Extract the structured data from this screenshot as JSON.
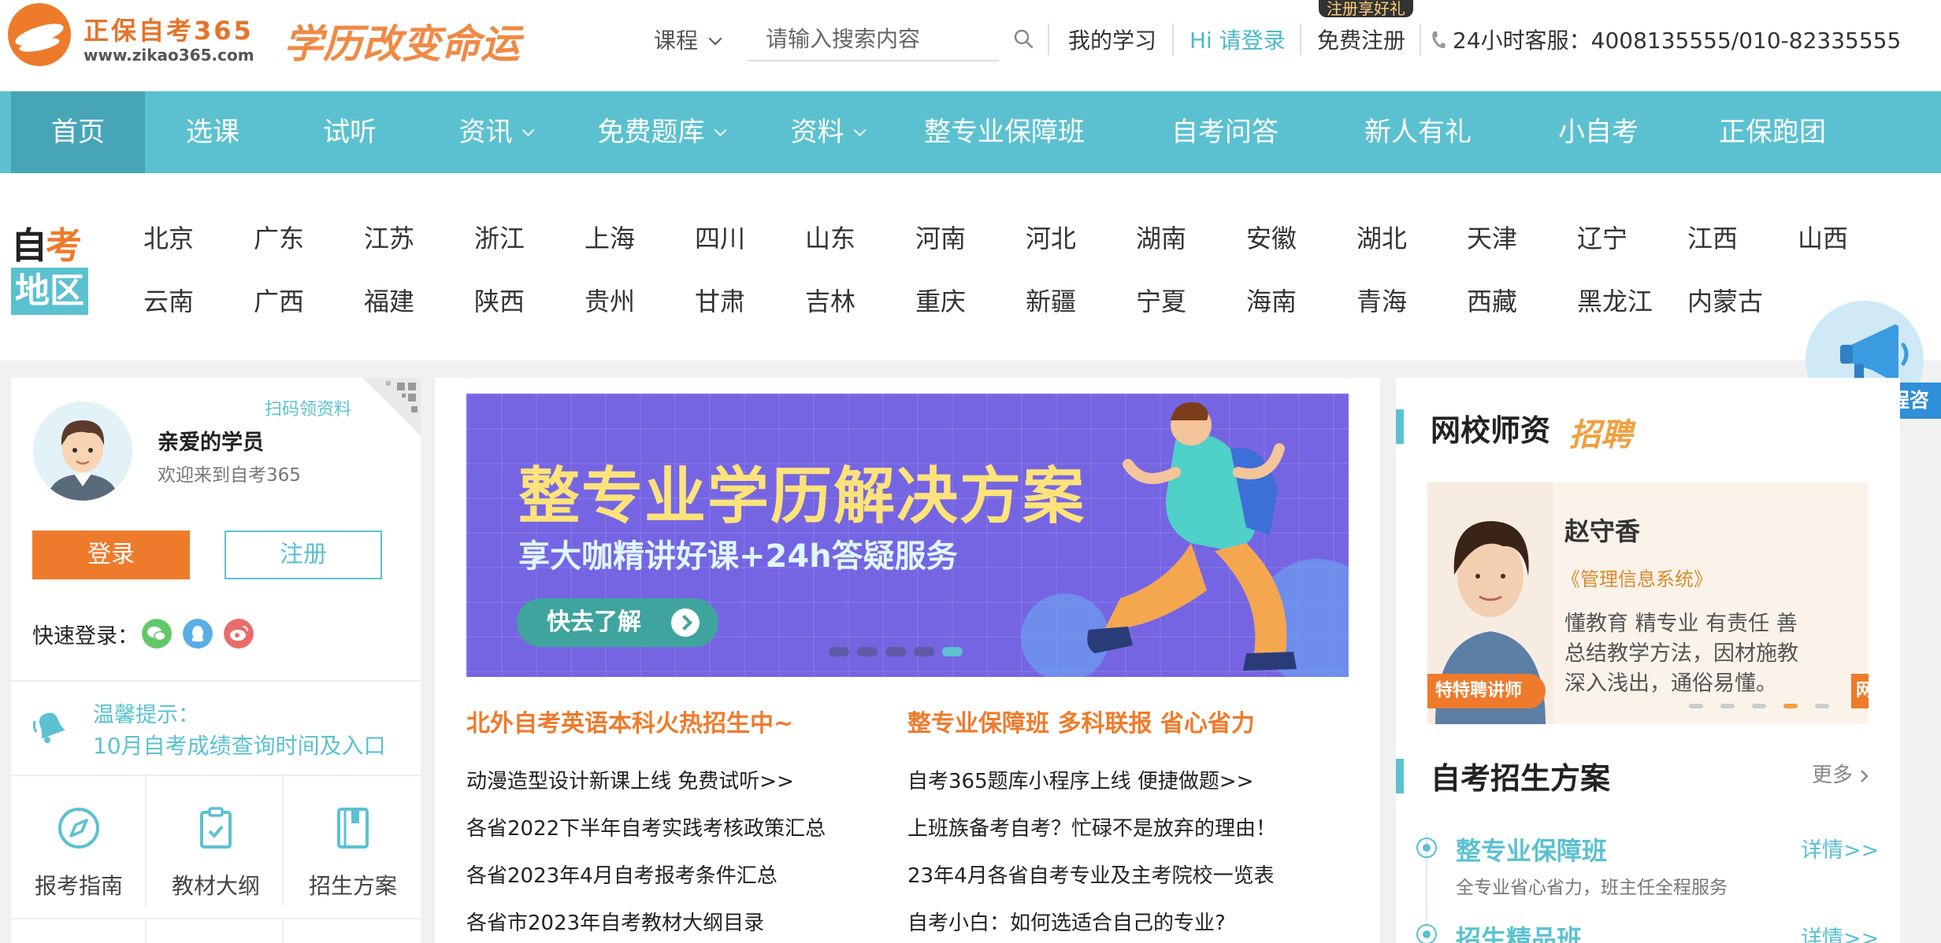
{
  "header": {
    "logo_title": "正保自考365",
    "logo_url": "www.zikao365.com",
    "slogan": "学历改变命运",
    "course_select": "课程",
    "search_placeholder": "请输入搜索内容",
    "my_study": "我的学习",
    "login": "Hi 请登录",
    "register": "免费注册",
    "register_tip": "注册享好礼",
    "service": "24小时客服：4008135555/010-82335555",
    "accent_color": "#5bc1d1",
    "brand_color": "#ee7b2c"
  },
  "nav": {
    "items": [
      {
        "label": "首页"
      },
      {
        "label": "选课"
      },
      {
        "label": "试听"
      },
      {
        "label": "资讯"
      },
      {
        "label": "免费题库"
      },
      {
        "label": "资料"
      },
      {
        "label": "整专业保障班"
      },
      {
        "label": "自考问答"
      },
      {
        "label": "新人有礼"
      },
      {
        "label": "小自考"
      },
      {
        "label": "正保跑团"
      }
    ]
  },
  "region": {
    "tag_line1_a": "自",
    "tag_line1_b": "考",
    "tag_line2": "地区",
    "provinces_row1": [
      "北京",
      "广东",
      "江苏",
      "浙江",
      "上海",
      "四川",
      "山东",
      "河南",
      "河北",
      "湖南",
      "安徽",
      "湖北",
      "天津",
      "辽宁",
      "江西",
      "山西"
    ],
    "provinces_row2": [
      "云南",
      "广西",
      "福建",
      "陕西",
      "贵州",
      "甘肃",
      "吉林",
      "重庆",
      "新疆",
      "宁夏",
      "海南",
      "青海",
      "西藏",
      "黑龙江",
      "内蒙古"
    ]
  },
  "megaphone": {
    "label": "自考报考流程咨"
  },
  "user_panel": {
    "scan_label": "扫码领资料",
    "user_name": "亲爱的学员",
    "welcome": "欢迎来到自考365",
    "login_button": "登录",
    "register_button": "注册",
    "quick_login": "快速登录：",
    "tip_title": "温馨提示：",
    "tip_link": "10月自考成绩查询时间及入口",
    "tiles": [
      {
        "label": "报考指南",
        "icon": "compass-icon"
      },
      {
        "label": "教材大纲",
        "icon": "clipboard-icon"
      },
      {
        "label": "招生方案",
        "icon": "book-icon"
      }
    ]
  },
  "banner": {
    "title": "整专业学历解决方案",
    "subtitle": "享大咖精讲好课+24h答疑服务",
    "button": "快去了解",
    "slide_count": 5,
    "active_slide": 5
  },
  "news": {
    "left_head": "北外自考英语本科火热招生中~",
    "right_head": "整专业保障班 多科联报 省心省力",
    "left_items": [
      "动漫造型设计新课上线 免费试听>>",
      "各省2022下半年自考实践考核政策汇总",
      "各省2023年4月自考报考条件汇总",
      "各省市2023年自考教材大纲目录"
    ],
    "right_items": [
      "自考365题库小程序上线 便捷做题>>",
      "上班族备考自考？忙碌不是放弃的理由！",
      "23年4月各省自考专业及主考院校一览表",
      "自考小白：如何选适合自己的专业?"
    ]
  },
  "teachers": {
    "title": "网校师资",
    "hire_badge": "招聘",
    "name": "赵守香",
    "course": "《管理信息系统》",
    "desc_lines": [
      "懂教育 精专业 有责任 善",
      "总结教学方法，因材施教",
      "深入浅出，通俗易懂。"
    ],
    "tag": "特特聘讲师",
    "tag2": "网校",
    "slide_count": 5,
    "active_slide": 4
  },
  "plans": {
    "title": "自考招生方案",
    "more": "更多",
    "items": [
      {
        "title": "整专业保障班",
        "desc": "全专业省心省力，班主任全程服务",
        "detail": "详情>>"
      },
      {
        "title": "招生精品班",
        "desc": "",
        "detail": "详情>>"
      }
    ]
  }
}
